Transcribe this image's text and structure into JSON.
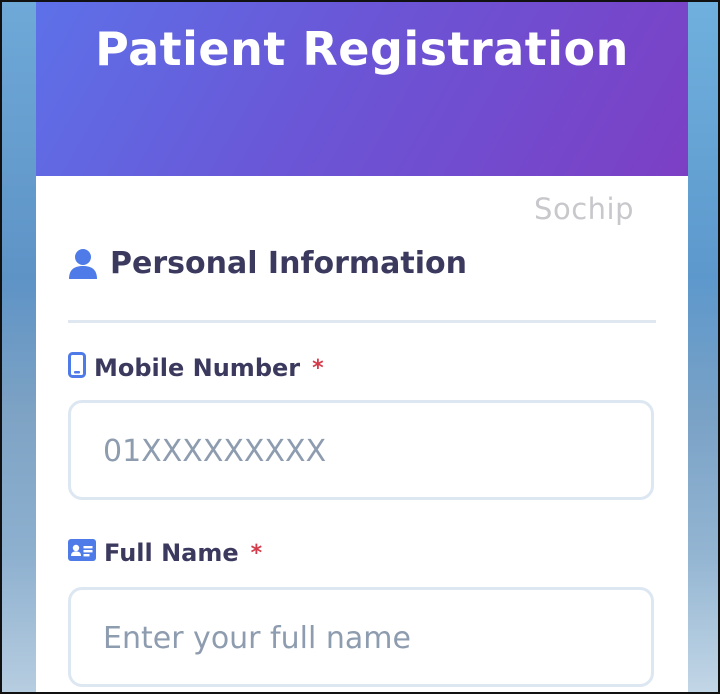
{
  "header": {
    "title": "Patient Registration"
  },
  "watermark": "Sochip",
  "section": {
    "title": "Personal Information",
    "icon": "user-icon"
  },
  "fields": [
    {
      "label": "Mobile Number",
      "required_mark": "*",
      "placeholder": "01XXXXXXXXX",
      "value": "",
      "icon": "mobile-phone-icon"
    },
    {
      "label": "Full Name",
      "required_mark": "*",
      "placeholder": "Enter your full name",
      "value": "",
      "icon": "id-card-icon"
    }
  ],
  "colors": {
    "header_gradient_start": "#5d71e8",
    "header_gradient_end": "#7c3fc4",
    "label_text": "#3b3a5e",
    "icon_blue": "#4f7be8",
    "required": "#d33b4a",
    "input_border": "#dde7f2",
    "placeholder": "#8e9cb0"
  }
}
